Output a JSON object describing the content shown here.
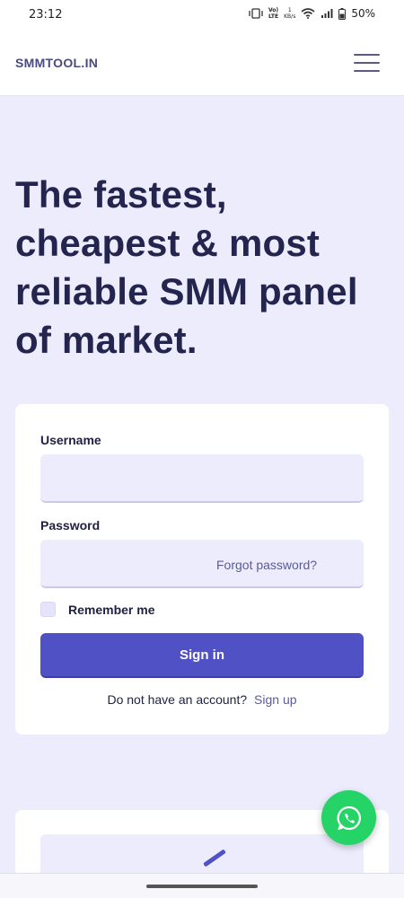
{
  "status_bar": {
    "time": "23:12",
    "volte_top": "Vo)",
    "volte_bottom": "LTE",
    "speed_value": "1",
    "speed_unit": "KB/s",
    "battery": "50%",
    "icons": [
      "vibrate-icon",
      "volte-icon",
      "data-speed-icon",
      "wifi-icon",
      "signal-icon",
      "battery-icon"
    ]
  },
  "navbar": {
    "brand": "SMMTOOL.IN",
    "menu_icon": "hamburger-menu-icon"
  },
  "hero": {
    "title": "The fastest, cheapest & most reliable SMM panel of market."
  },
  "login": {
    "username_label": "Username",
    "username_value": "",
    "password_label": "Password",
    "password_value": "",
    "forgot_password": "Forgot password?",
    "remember_label": "Remember me",
    "remember_checked": false,
    "signin_label": "Sign in",
    "no_account_text": "Do not have an account?",
    "signup_link": "Sign up"
  },
  "fab": {
    "icon": "whatsapp-icon",
    "color": "#25d366"
  },
  "colors": {
    "accent": "#5151c6",
    "background": "#ececfd",
    "heading": "#23254e"
  }
}
